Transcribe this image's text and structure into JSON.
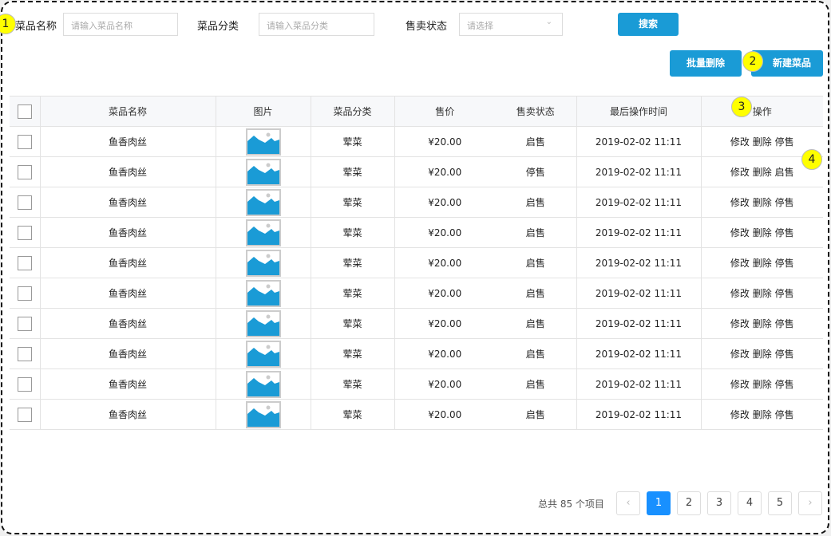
{
  "filters": {
    "name_label": "菜品名称",
    "name_placeholder": "请输入菜品名称",
    "category_label": "菜品分类",
    "category_placeholder": "请输入菜品分类",
    "status_label": "售卖状态",
    "status_placeholder": "请选择",
    "search_label": "搜索"
  },
  "toolbar": {
    "batch_delete": "批量删除",
    "new_dish": "新建菜品"
  },
  "annotations": [
    "1",
    "2",
    "3",
    "4"
  ],
  "table": {
    "headers": [
      "菜品名称",
      "图片",
      "菜品分类",
      "售价",
      "售卖状态",
      "最后操作时间",
      "操作"
    ],
    "rows": [
      {
        "name": "鱼香肉丝",
        "category": "荤菜",
        "price": "¥20.00",
        "status": "启售",
        "time": "2019-02-02 11:11",
        "edit": "修改",
        "delete": "删除",
        "toggle": "停售"
      },
      {
        "name": "鱼香肉丝",
        "category": "荤菜",
        "price": "¥20.00",
        "status": "停售",
        "time": "2019-02-02 11:11",
        "edit": "修改",
        "delete": "删除",
        "toggle": "启售"
      },
      {
        "name": "鱼香肉丝",
        "category": "荤菜",
        "price": "¥20.00",
        "status": "启售",
        "time": "2019-02-02 11:11",
        "edit": "修改",
        "delete": "删除",
        "toggle": "停售"
      },
      {
        "name": "鱼香肉丝",
        "category": "荤菜",
        "price": "¥20.00",
        "status": "启售",
        "time": "2019-02-02 11:11",
        "edit": "修改",
        "delete": "删除",
        "toggle": "停售"
      },
      {
        "name": "鱼香肉丝",
        "category": "荤菜",
        "price": "¥20.00",
        "status": "启售",
        "time": "2019-02-02 11:11",
        "edit": "修改",
        "delete": "删除",
        "toggle": "停售"
      },
      {
        "name": "鱼香肉丝",
        "category": "荤菜",
        "price": "¥20.00",
        "status": "启售",
        "time": "2019-02-02 11:11",
        "edit": "修改",
        "delete": "删除",
        "toggle": "停售"
      },
      {
        "name": "鱼香肉丝",
        "category": "荤菜",
        "price": "¥20.00",
        "status": "启售",
        "time": "2019-02-02 11:11",
        "edit": "修改",
        "delete": "删除",
        "toggle": "停售"
      },
      {
        "name": "鱼香肉丝",
        "category": "荤菜",
        "price": "¥20.00",
        "status": "启售",
        "time": "2019-02-02 11:11",
        "edit": "修改",
        "delete": "删除",
        "toggle": "停售"
      },
      {
        "name": "鱼香肉丝",
        "category": "荤菜",
        "price": "¥20.00",
        "status": "启售",
        "time": "2019-02-02 11:11",
        "edit": "修改",
        "delete": "删除",
        "toggle": "停售"
      },
      {
        "name": "鱼香肉丝",
        "category": "荤菜",
        "price": "¥20.00",
        "status": "启售",
        "time": "2019-02-02 11:11",
        "edit": "修改",
        "delete": "删除",
        "toggle": "停售"
      }
    ]
  },
  "pagination": {
    "total_text": "总共 85 个项目",
    "pages": [
      "1",
      "2",
      "3",
      "4",
      "5"
    ],
    "current": "1",
    "prev": "‹",
    "next": "›"
  },
  "colors": {
    "primary": "#1a9bd6",
    "active_page": "#1890ff",
    "annotation": "#ffff00"
  }
}
